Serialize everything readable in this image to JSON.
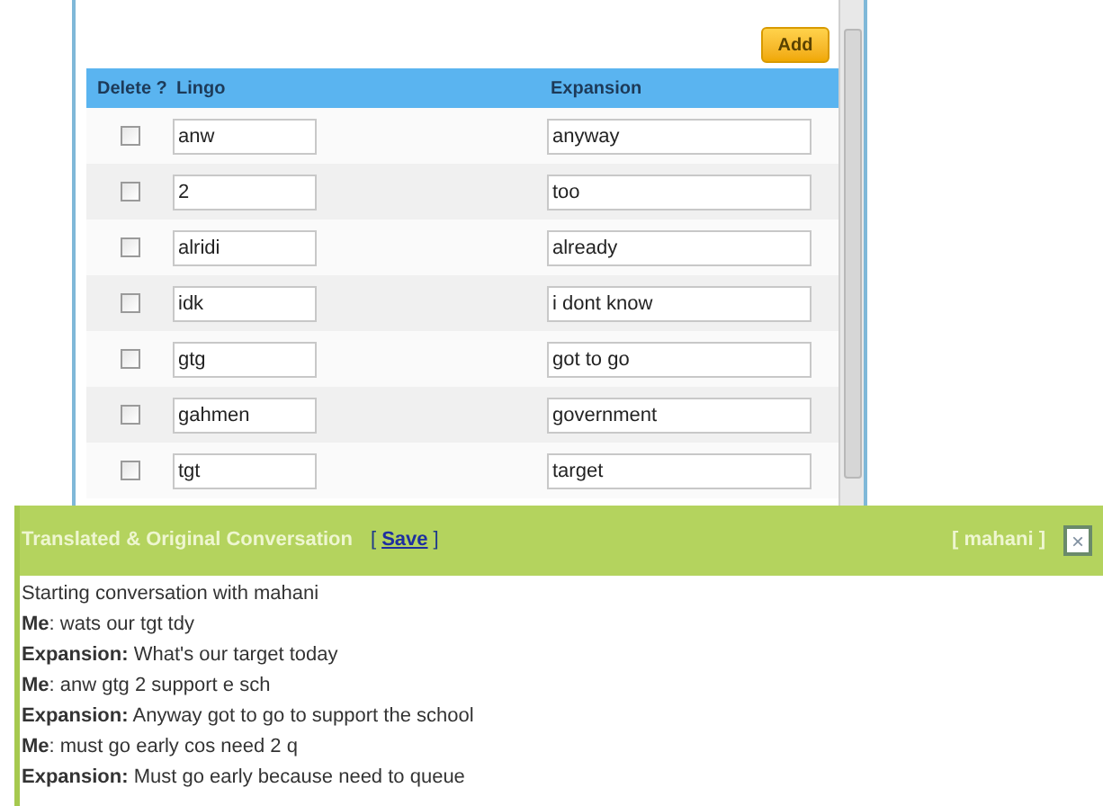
{
  "add_button": "Add",
  "table": {
    "columns": [
      "Delete ?",
      "Lingo",
      "Expansion"
    ],
    "rows": [
      {
        "checked": false,
        "lingo": "anw",
        "expansion": "anyway"
      },
      {
        "checked": false,
        "lingo": "2",
        "expansion": "too"
      },
      {
        "checked": false,
        "lingo": "alridi",
        "expansion": "already"
      },
      {
        "checked": false,
        "lingo": "idk",
        "expansion": "i dont know"
      },
      {
        "checked": false,
        "lingo": "gtg",
        "expansion": "got to go"
      },
      {
        "checked": false,
        "lingo": "gahmen",
        "expansion": "government"
      },
      {
        "checked": false,
        "lingo": "tgt",
        "expansion": "target"
      }
    ]
  },
  "conversation": {
    "title": "Translated & Original Conversation",
    "save_open": "[",
    "save_link": "Save",
    "save_close": "]",
    "user": "[ mahani ]",
    "close": "×",
    "lines": [
      "Starting conversation with mahani",
      "**Me**: wats our tgt tdy",
      "**Expansion:** What's our target today",
      "**Me**: anw gtg 2 support e sch",
      "**Expansion:** Anyway got to go to support the school",
      "**Me**: must go early cos need 2 q",
      "**Expansion:** Must go early because need to queue"
    ]
  }
}
